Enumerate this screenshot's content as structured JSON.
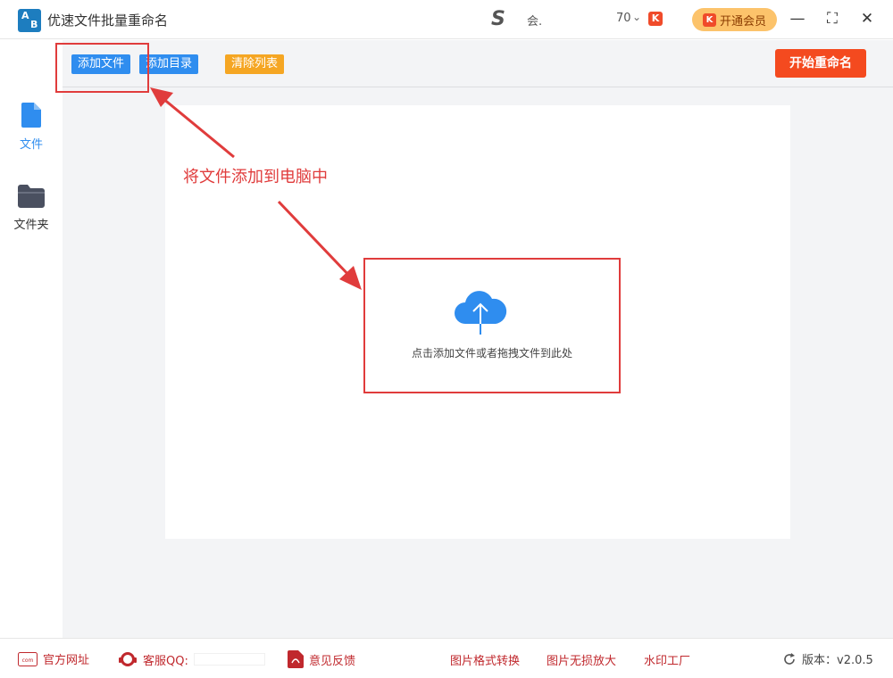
{
  "app": {
    "title": "优速文件批量重命名",
    "logo_text_a": "A",
    "logo_text_b": "B"
  },
  "account": {
    "avatar_glyph": "S",
    "name": "会.",
    "number": "70",
    "vip_button_label": "开通会员",
    "badge_glyph": "K"
  },
  "window_controls": {
    "minimize": "—",
    "maximize": "⛶",
    "close": "✕"
  },
  "toolbar": {
    "add_file": "添加文件",
    "add_folder": "添加目录",
    "clear_list": "清除列表",
    "start_rename": "开始重命名"
  },
  "sidebar": {
    "items": [
      {
        "label": "文件",
        "icon": "file-icon",
        "active": true,
        "color": "#2f8def"
      },
      {
        "label": "文件夹",
        "icon": "folder-icon",
        "active": false,
        "color": "#333333"
      }
    ]
  },
  "main": {
    "annotation": "将文件添加到电脑中",
    "drop_hint": "点击添加文件或者拖拽文件到此处"
  },
  "footer": {
    "website": "官方网址",
    "qq_label": "客服QQ:",
    "feedback": "意见反馈",
    "links": [
      "图片格式转换",
      "图片无损放大",
      "水印工厂"
    ],
    "version": "版本：v2.0.5"
  },
  "colors": {
    "accent_blue": "#2f8def",
    "accent_orange": "#f5a623",
    "start_red": "#f44a1f",
    "annotation_red": "#e03c3c"
  }
}
